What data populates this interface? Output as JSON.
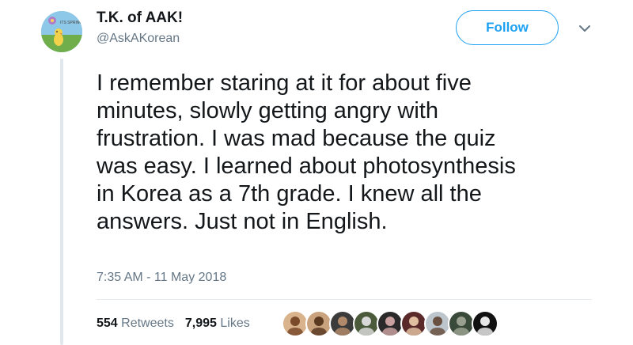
{
  "author": {
    "display_name": "T.K. of AAK!",
    "handle": "@AskAKorean",
    "avatar_caption": "ITS SPRING!"
  },
  "follow_label": "Follow",
  "tweet_text": "I remember staring at it for about five\nminutes, slowly getting angry with\nfrustration. I was mad because the quiz\nwas easy. I learned about photosynthesis\nin Korea as a 7th grade. I knew all the\nanswers. Just not in English.",
  "timestamp": "7:35 AM - 11 May 2018",
  "stats": {
    "retweets_count": "554",
    "retweets_label": "Retweets",
    "likes_count": "7,995",
    "likes_label": "Likes"
  },
  "colors": {
    "accent": "#1da1f2",
    "secondary_text": "#657786",
    "primary_text": "#14171a"
  },
  "liker_avatars": [
    {
      "name": "liker-avatar-1",
      "bg": "#d9b38c",
      "fg": "#7a4a2a"
    },
    {
      "name": "liker-avatar-2",
      "bg": "#c9a27e",
      "fg": "#5b3a22"
    },
    {
      "name": "liker-avatar-3",
      "bg": "#3b3b3b",
      "fg": "#b08a6a"
    },
    {
      "name": "liker-avatar-4",
      "bg": "#4a5a3a",
      "fg": "#d8d8d8"
    },
    {
      "name": "liker-avatar-5",
      "bg": "#2a2a2a",
      "fg": "#c8a0a0"
    },
    {
      "name": "liker-avatar-6",
      "bg": "#5a2a2a",
      "fg": "#e0c0a0"
    },
    {
      "name": "liker-avatar-7",
      "bg": "#bcc6cc",
      "fg": "#6a5040"
    },
    {
      "name": "liker-avatar-8",
      "bg": "#3a4a3a",
      "fg": "#9aa090"
    },
    {
      "name": "liker-avatar-9",
      "bg": "#111111",
      "fg": "#e8e8e8"
    }
  ]
}
